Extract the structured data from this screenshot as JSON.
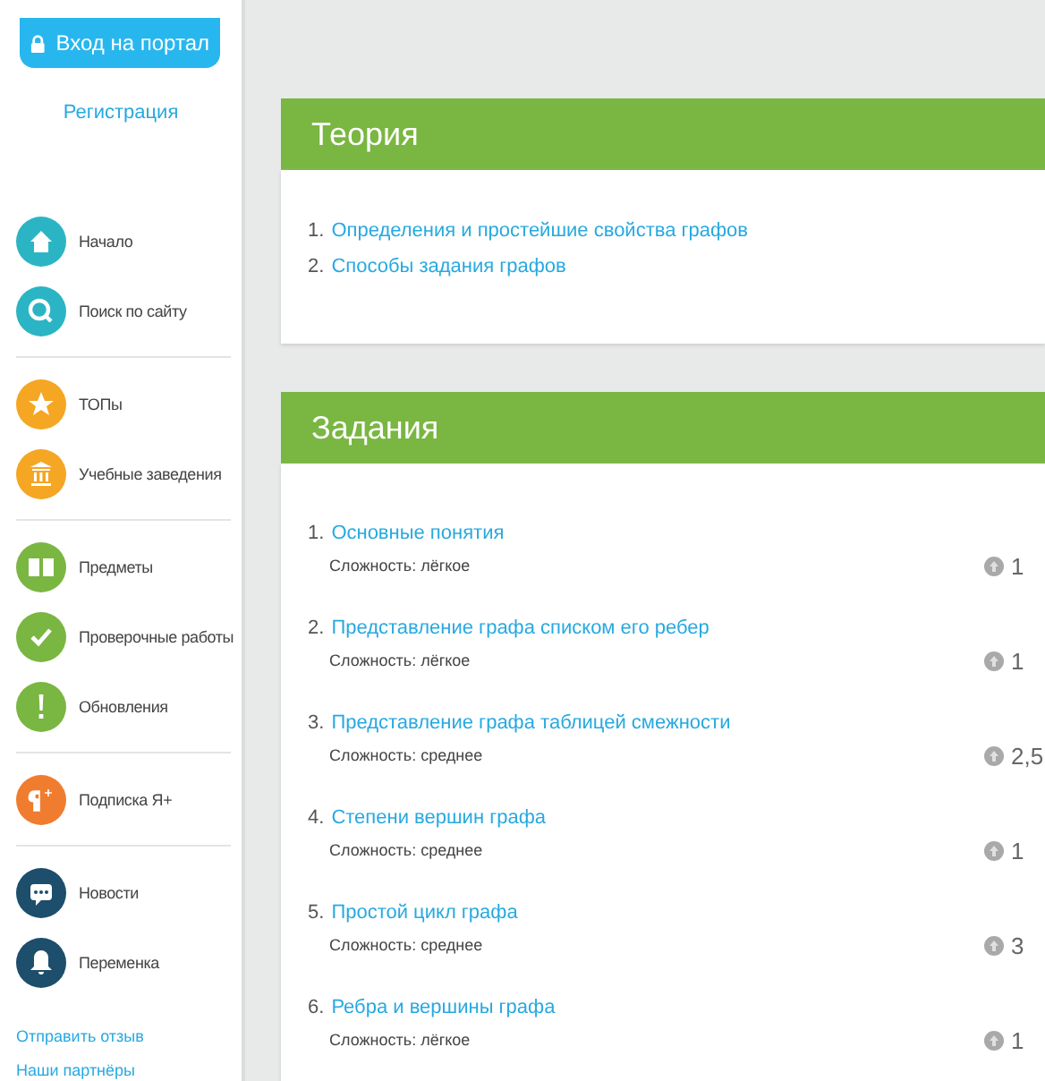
{
  "sidebar": {
    "login_button": "Вход на портал",
    "register_link": "Регистрация",
    "nav_groups": [
      [
        {
          "label": "Начало",
          "kind": "home",
          "color": "#2bb5c4"
        },
        {
          "label": "Поиск по сайту",
          "kind": "search",
          "color": "#2bb5c4"
        }
      ],
      [
        {
          "label": "ТОПы",
          "kind": "star",
          "color": "#f5a623"
        },
        {
          "label": "Учебные заведения",
          "kind": "building",
          "color": "#f5a623"
        }
      ],
      [
        {
          "label": "Предметы",
          "kind": "book",
          "color": "#7ab642"
        },
        {
          "label": "Проверочные работы",
          "kind": "check",
          "color": "#7ab642"
        },
        {
          "label": "Обновления",
          "kind": "exclaim",
          "color": "#7ab642"
        }
      ],
      [
        {
          "label": "Подписка Я+",
          "kind": "yaplus",
          "color": "#f07c30"
        }
      ],
      [
        {
          "label": "Новости",
          "kind": "chat",
          "color": "#1d4e6b"
        },
        {
          "label": "Переменка",
          "kind": "bell",
          "color": "#1d4e6b"
        }
      ]
    ],
    "footer_links": [
      "Отправить отзыв",
      "Наши партнёры"
    ]
  },
  "theory": {
    "title": "Теория",
    "items": [
      {
        "number": "1.",
        "title": "Определения и простейшие свойства графов"
      },
      {
        "number": "2.",
        "title": "Способы задания графов"
      }
    ]
  },
  "tasks": {
    "title": "Задания",
    "items": [
      {
        "number": "1.",
        "title": "Основные понятия",
        "difficulty": "Сложность: лёгкое",
        "points": "1"
      },
      {
        "number": "2.",
        "title": "Представление графа списком его ребер",
        "difficulty": "Сложность: лёгкое",
        "points": "1"
      },
      {
        "number": "3.",
        "title": "Представление графа таблицей смежности",
        "difficulty": "Сложность: среднее",
        "points": "2,5"
      },
      {
        "number": "4.",
        "title": "Степени вершин графа",
        "difficulty": "Сложность: среднее",
        "points": "1"
      },
      {
        "number": "5.",
        "title": "Простой цикл графа",
        "difficulty": "Сложность: среднее",
        "points": "3"
      },
      {
        "number": "6.",
        "title": "Ребра и вершины графа",
        "difficulty": "Сложность: лёгкое",
        "points": "1"
      }
    ]
  }
}
